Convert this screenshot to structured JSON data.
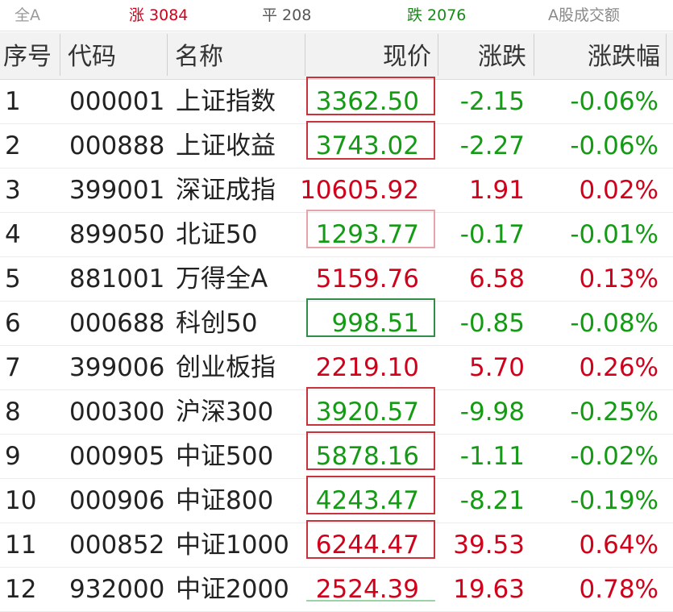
{
  "summary": {
    "all": "全A",
    "up": "涨 3084",
    "flat": "平 208",
    "down": "跌 2076",
    "amount": "A股成交额"
  },
  "columns": {
    "seq": "序号",
    "code": "代码",
    "name": "名称",
    "price": "现价",
    "change": "涨跌",
    "pct": "涨跌幅"
  },
  "colors": {
    "up": "#d0021b",
    "down": "#159a15",
    "box_red": "#c8323a",
    "box_pink": "#e8a2a8",
    "box_green": "#2f8f4a"
  },
  "rows": [
    {
      "seq": "1",
      "code": "000001",
      "name": "上证指数",
      "price": "3362.50",
      "change": "-2.15",
      "pct": "-0.06%",
      "dir": "down",
      "box": "red"
    },
    {
      "seq": "2",
      "code": "000888",
      "name": "上证收益",
      "price": "3743.02",
      "change": "-2.27",
      "pct": "-0.06%",
      "dir": "down",
      "box": "red"
    },
    {
      "seq": "3",
      "code": "399001",
      "name": "深证成指",
      "price": "10605.92",
      "change": "1.91",
      "pct": "0.02%",
      "dir": "up",
      "box": "none"
    },
    {
      "seq": "4",
      "code": "899050",
      "name": "北证50",
      "price": "1293.77",
      "change": "-0.17",
      "pct": "-0.01%",
      "dir": "down",
      "box": "pink"
    },
    {
      "seq": "5",
      "code": "881001",
      "name": "万得全A",
      "price": "5159.76",
      "change": "6.58",
      "pct": "0.13%",
      "dir": "up",
      "box": "none"
    },
    {
      "seq": "6",
      "code": "000688",
      "name": "科创50",
      "price": "998.51",
      "change": "-0.85",
      "pct": "-0.08%",
      "dir": "down",
      "box": "green"
    },
    {
      "seq": "7",
      "code": "399006",
      "name": "创业板指",
      "price": "2219.10",
      "change": "5.70",
      "pct": "0.26%",
      "dir": "up",
      "box": "none"
    },
    {
      "seq": "8",
      "code": "000300",
      "name": "沪深300",
      "price": "3920.57",
      "change": "-9.98",
      "pct": "-0.25%",
      "dir": "down",
      "box": "red"
    },
    {
      "seq": "9",
      "code": "000905",
      "name": "中证500",
      "price": "5878.16",
      "change": "-1.11",
      "pct": "-0.02%",
      "dir": "down",
      "box": "red"
    },
    {
      "seq": "10",
      "code": "000906",
      "name": "中证800",
      "price": "4243.47",
      "change": "-8.21",
      "pct": "-0.19%",
      "dir": "down",
      "box": "red"
    },
    {
      "seq": "11",
      "code": "000852",
      "name": "中证1000",
      "price": "6244.47",
      "change": "39.53",
      "pct": "0.64%",
      "dir": "up",
      "box": "red"
    },
    {
      "seq": "12",
      "code": "932000",
      "name": "中证2000",
      "price": "2524.39",
      "change": "19.63",
      "pct": "0.78%",
      "dir": "up",
      "box": "none"
    }
  ]
}
